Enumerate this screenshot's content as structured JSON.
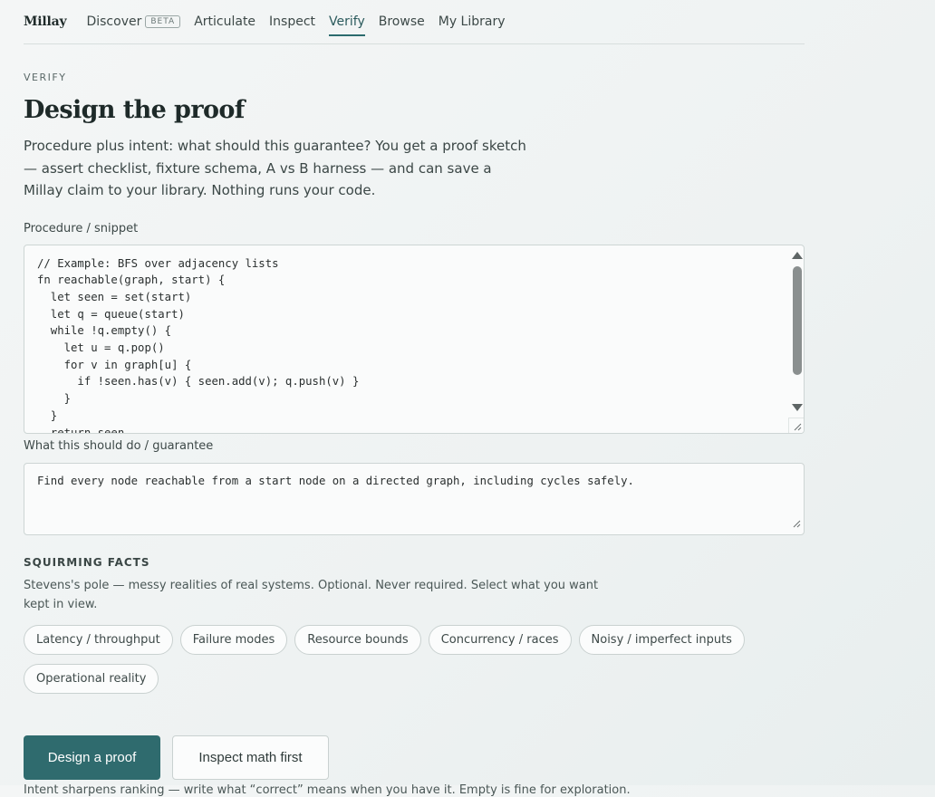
{
  "nav": {
    "brand": "Millay",
    "items": [
      {
        "label": "Discover",
        "badge": "BETA"
      },
      {
        "label": "Articulate"
      },
      {
        "label": "Inspect"
      },
      {
        "label": "Verify",
        "active": true
      },
      {
        "label": "Browse"
      },
      {
        "label": "My Library"
      }
    ]
  },
  "header": {
    "eyebrow": "VERIFY",
    "title": "Design the proof",
    "lede": "Procedure plus intent: what should this guarantee? You get a proof sketch — assert checklist, fixture schema, A vs B harness — and can save a Millay claim to your library. Nothing runs your code."
  },
  "procedure": {
    "label": "Procedure / snippet",
    "value": "// Example: BFS over adjacency lists\nfn reachable(graph, start) {\n  let seen = set(start)\n  let q = queue(start)\n  while !q.empty() {\n    let u = q.pop()\n    for v in graph[u] {\n      if !seen.has(v) { seen.add(v); q.push(v) }\n    }\n  }\n  return seen\n}"
  },
  "intent": {
    "label": "What this should do / guarantee",
    "value": "Find every node reachable from a start node on a directed graph, including cycles safely."
  },
  "facts": {
    "heading": "SQUIRMING FACTS",
    "description": "Stevens's pole — messy realities of real systems. Optional. Never required. Select what you want kept in view.",
    "chips": [
      "Latency / throughput",
      "Failure modes",
      "Resource bounds",
      "Concurrency / races",
      "Noisy / imperfect inputs",
      "Operational reality"
    ]
  },
  "actions": {
    "primary": "Design a proof",
    "secondary": "Inspect math first",
    "note": "Intent sharpens ranking — write what “correct” means when you have it. Empty is fine for exploration."
  },
  "colors": {
    "accent": "#2f6b6e",
    "text": "#2f3b3a",
    "border": "#cdd5d4"
  }
}
